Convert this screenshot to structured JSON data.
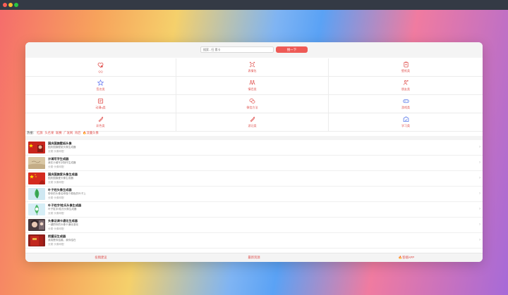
{
  "search": {
    "placeholder": "搜索...扫 素卡",
    "button_label": "搜一下"
  },
  "categories": [
    {
      "label": "QQ",
      "icon": "qq-icon"
    },
    {
      "label": "表情包",
      "icon": "emoji-icon"
    },
    {
      "label": "壁纸类",
      "icon": "wallpaper-icon"
    },
    {
      "label": "签名类",
      "icon": "star-icon"
    },
    {
      "label": "情侣类",
      "icon": "couple-icon"
    },
    {
      "label": "朋友类",
      "icon": "friends-icon"
    },
    {
      "label": "动漫q类",
      "icon": "anime-icon"
    },
    {
      "label": "微信方法",
      "icon": "wechat-icon"
    },
    {
      "label": "游戏类",
      "icon": "gamepad-icon"
    },
    {
      "label": "彩色类",
      "icon": "paint-icon"
    },
    {
      "label": "游记类",
      "icon": "paint-icon"
    },
    {
      "label": "学习类",
      "icon": "study-icon"
    }
  ],
  "hot": {
    "prefix": "热搜：",
    "tags": [
      "红旗",
      "头名果",
      "联赛",
      "广发网",
      "背后",
      "🔥流量头像"
    ]
  },
  "list": [
    {
      "title": "国庆国旗壁纸头像",
      "desc": "国庆国旗壁纸头像生成器",
      "meta": "分类·头像印配",
      "thumb": "flag"
    },
    {
      "title": "沙滩写字生成器",
      "desc": "我在沙滩写字制作生成器",
      "meta": "分类·头像印配",
      "thumb": "sand"
    },
    {
      "title": "国庆国旗爱头像生成器",
      "desc": "国庆国旗爱头像生成器",
      "meta": "分类·头像印配",
      "thumb": "flag"
    },
    {
      "title": "叶子姓头像生成器",
      "desc": "带你的头像名称做个颜色的叶子上",
      "meta": "分类·头像印配",
      "thumb": "leaf"
    },
    {
      "title": "叶子姓字/姓氏头像生成器",
      "desc": "叶子姓字/姓氏头像生成器",
      "meta": "分类·头像印配",
      "thumb": "leaf2"
    },
    {
      "title": "头像证调卡通化生成器",
      "desc": "一键把你的头像卡通化漫化",
      "meta": "分类·头像印配",
      "thumb": "cartoon"
    },
    {
      "title": "把握证生成器",
      "desc": "我真是你结婚，我你结在",
      "meta": "分类·头像印配",
      "thumb": "book"
    }
  ],
  "bottom": {
    "left": "投稿建议",
    "center": "最新资源",
    "right": "🔥客端APP"
  },
  "colors": {
    "accent": "#ee5a56",
    "label": "#e0524f"
  }
}
